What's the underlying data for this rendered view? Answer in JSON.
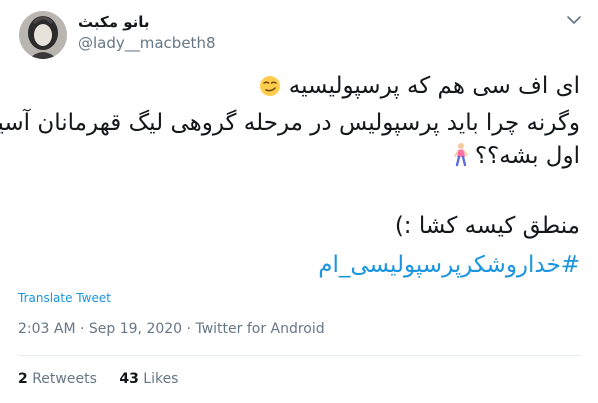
{
  "author": {
    "display_name": "بانو مکبث",
    "handle": "@lady__macbeth8"
  },
  "tweet": {
    "line1": "ای اف سی هم که پرسپولیسیه",
    "line2": "وگرنه چرا باید پرسپولیس در مرحله گروهی لیگ قهرمانان آسیا",
    "line3": "اول بشه؟؟",
    "line4": "منطق کیسه کشا :)",
    "hashtag": "#خداروشکرپرسپولیسی_ام"
  },
  "translate_label": "Translate Tweet",
  "meta": {
    "time": "2:03 AM",
    "date": "Sep 19, 2020",
    "source": "Twitter for Android"
  },
  "stats": {
    "retweets_count": "2",
    "retweets_label": "Retweets",
    "likes_count": "43",
    "likes_label": "Likes"
  },
  "colors": {
    "link": "#1b95e0",
    "muted": "#657786",
    "text": "#14171a"
  },
  "icons": {
    "face": "smirking-face-emoji",
    "person": "person-walking-emoji",
    "menu": "chevron-down-icon"
  }
}
